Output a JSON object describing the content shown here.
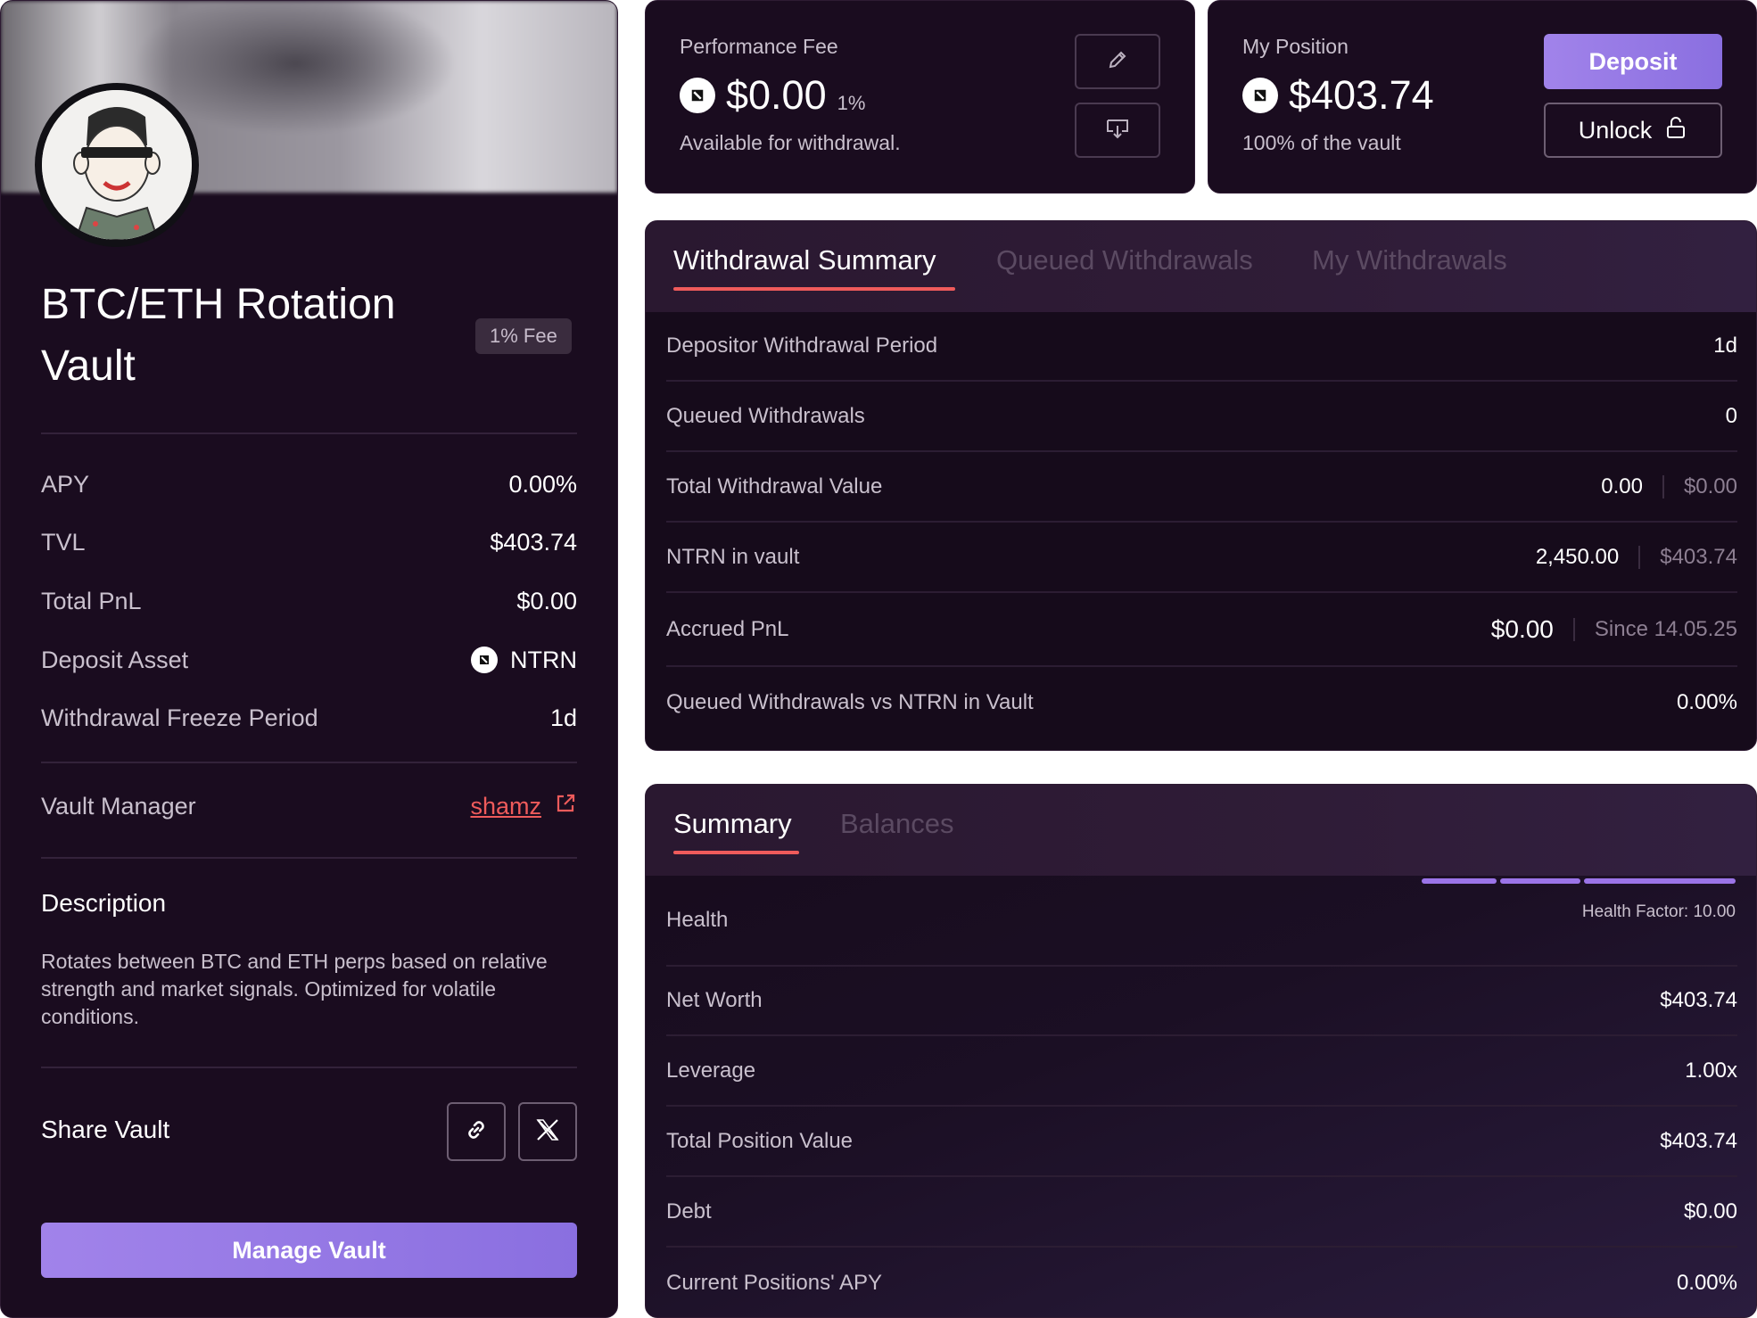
{
  "vault": {
    "title": "BTC/ETH Rotation Vault",
    "fee_badge": "1% Fee",
    "stats": [
      {
        "label": "APY",
        "value": "0.00%"
      },
      {
        "label": "TVL",
        "value": "$403.74"
      },
      {
        "label": "Total PnL",
        "value": "$0.00"
      },
      {
        "label": "Deposit Asset",
        "value": "NTRN"
      },
      {
        "label": "Withdrawal Freeze Period",
        "value": "1d"
      }
    ],
    "manager_label": "Vault Manager",
    "manager_name": "shamz",
    "description_title": "Description",
    "description": "Rotates between BTC and ETH perps based on relative strength and market signals. Optimized for volatile conditions.",
    "share_title": "Share Vault",
    "manage_button": "Manage Vault"
  },
  "performance_fee": {
    "label": "Performance Fee",
    "amount": "$0.00",
    "percent": "1%",
    "sub": "Available for withdrawal."
  },
  "position": {
    "label": "My Position",
    "amount": "$403.74",
    "sub": "100% of the vault",
    "deposit_button": "Deposit",
    "unlock_button": "Unlock"
  },
  "withdrawal_panel": {
    "tabs": [
      "Withdrawal Summary",
      "Queued Withdrawals",
      "My Withdrawals"
    ],
    "rows": [
      {
        "label": "Depositor Withdrawal Period",
        "value": "1d"
      },
      {
        "label": "Queued Withdrawals",
        "value": "0"
      },
      {
        "label": "Total Withdrawal Value",
        "value": "0.00",
        "secondary": "$0.00"
      },
      {
        "label": "NTRN in vault",
        "value": "2,450.00",
        "secondary": "$403.74"
      },
      {
        "label": "Accrued PnL",
        "value": "$0.00",
        "secondary": "Since 14.05.25"
      },
      {
        "label": "Queued Withdrawals vs NTRN in Vault",
        "value": "0.00%"
      }
    ]
  },
  "summary_panel": {
    "tabs": [
      "Summary",
      "Balances"
    ],
    "health_label": "Health",
    "health_factor": "Health Factor: 10.00",
    "health_level": 1.0,
    "rows": [
      {
        "label": "Net Worth",
        "value": "$403.74"
      },
      {
        "label": "Leverage",
        "value": "1.00x"
      },
      {
        "label": "Total Position Value",
        "value": "$403.74"
      },
      {
        "label": "Debt",
        "value": "$0.00"
      },
      {
        "label": "Current Positions' APY",
        "value": "0.00%"
      }
    ]
  },
  "colors": {
    "background": "#1a0c1f",
    "accent": "#9b74e8",
    "tab_underline": "#ef5b5b",
    "manager_link": "#ef5b5b"
  },
  "icons": [
    "ntrn-token-icon",
    "external-link-icon",
    "link-icon",
    "x-logo-icon",
    "pencil-icon",
    "download-icon",
    "unlock-icon"
  ]
}
